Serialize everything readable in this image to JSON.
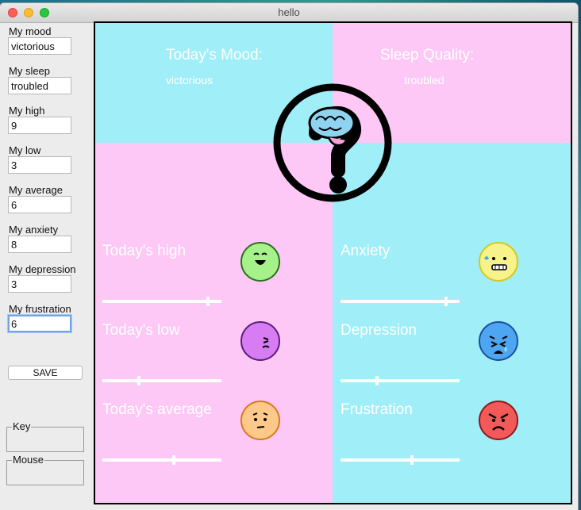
{
  "window": {
    "title": "hello"
  },
  "sidebar": {
    "fields": [
      {
        "label": "My mood",
        "value": "victorious"
      },
      {
        "label": "My sleep",
        "value": "troubled"
      },
      {
        "label": "My high",
        "value": "9"
      },
      {
        "label": "My low",
        "value": "3"
      },
      {
        "label": "My average",
        "value": "6"
      },
      {
        "label": "My anxiety",
        "value": "8"
      },
      {
        "label": "My depression",
        "value": "3"
      },
      {
        "label": "My frustration",
        "value": "6"
      }
    ],
    "save_label": "SAVE",
    "key_label": "Key",
    "mouse_label": "Mouse"
  },
  "dashboard": {
    "mood_title": "Today's Mood:",
    "mood_value": "victorious",
    "sleep_title": "Sleep Quality:",
    "sleep_value": "troubled",
    "left_metrics": [
      {
        "label": "Today's high",
        "value": 9,
        "max": 10,
        "icon": "happy-face-icon",
        "color": "#a6f28a"
      },
      {
        "label": "Today's low",
        "value": 3,
        "max": 10,
        "icon": "tired-face-icon",
        "color": "#d77cf2"
      },
      {
        "label": "Today's average",
        "value": 6,
        "max": 10,
        "icon": "neutral-face-icon",
        "color": "#fdc98a"
      }
    ],
    "right_metrics": [
      {
        "label": "Anxiety",
        "value": 9,
        "max": 10,
        "icon": "anxious-face-icon",
        "color": "#f7f38a"
      },
      {
        "label": "Depression",
        "value": 3,
        "max": 10,
        "icon": "crying-face-icon",
        "color": "#4ea6f2"
      },
      {
        "label": "Frustration",
        "value": 6,
        "max": 10,
        "icon": "angry-face-icon",
        "color": "#f25a5a"
      }
    ],
    "colors": {
      "cyan": "#a0eef8",
      "pink": "#fdc8f6"
    },
    "center_logo": "brain-question-mark-logo"
  }
}
